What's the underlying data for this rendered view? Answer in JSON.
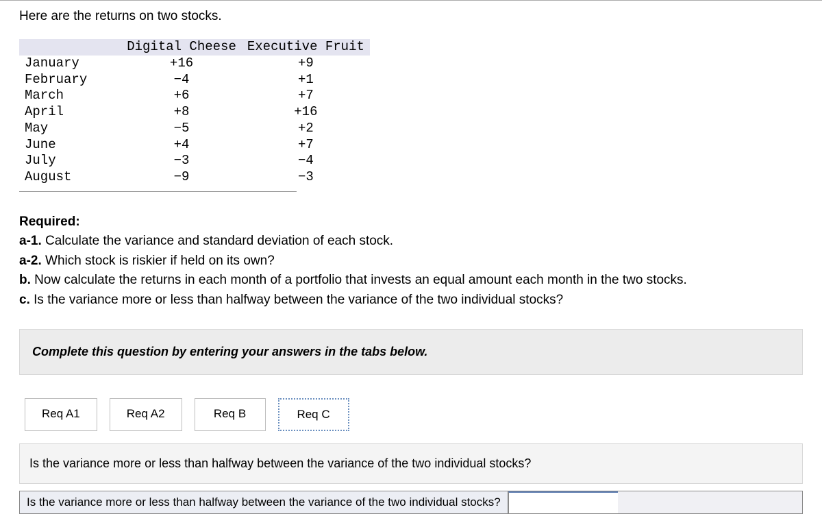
{
  "intro": "Here are the returns on two stocks.",
  "table": {
    "headers": [
      "Digital Cheese",
      "Executive Fruit"
    ],
    "rows": [
      {
        "month": "January",
        "c1": "+16",
        "c2": "+9"
      },
      {
        "month": "February",
        "c1": "−4",
        "c2": "+1"
      },
      {
        "month": "March",
        "c1": "+6",
        "c2": "+7"
      },
      {
        "month": "April",
        "c1": "+8",
        "c2": "+16"
      },
      {
        "month": "May",
        "c1": "−5",
        "c2": "+2"
      },
      {
        "month": "June",
        "c1": "+4",
        "c2": "+7"
      },
      {
        "month": "July",
        "c1": "−3",
        "c2": "−4"
      },
      {
        "month": "August",
        "c1": "−9",
        "c2": "−3"
      }
    ]
  },
  "required": {
    "label": "Required:",
    "a1_pre": "a-1.",
    "a1": " Calculate the variance and standard deviation of each stock.",
    "a2_pre": "a-2.",
    "a2": " Which stock is riskier if held on its own?",
    "b_pre": "b.",
    "b": " Now calculate the returns in each month of a portfolio that invests an equal amount each month in the two stocks.",
    "c_pre": "c.",
    "c": " Is the variance more or less than halfway between the variance of the two individual stocks?"
  },
  "instruction": "Complete this question by entering your answers in the tabs below.",
  "tabs": {
    "a1": "Req A1",
    "a2": "Req A2",
    "b": "Req B",
    "c": "Req C"
  },
  "question_box": "Is the variance more or less than halfway between the variance of the two individual stocks?",
  "answer_label": "Is the variance more or less than halfway between the variance of the two individual stocks?"
}
